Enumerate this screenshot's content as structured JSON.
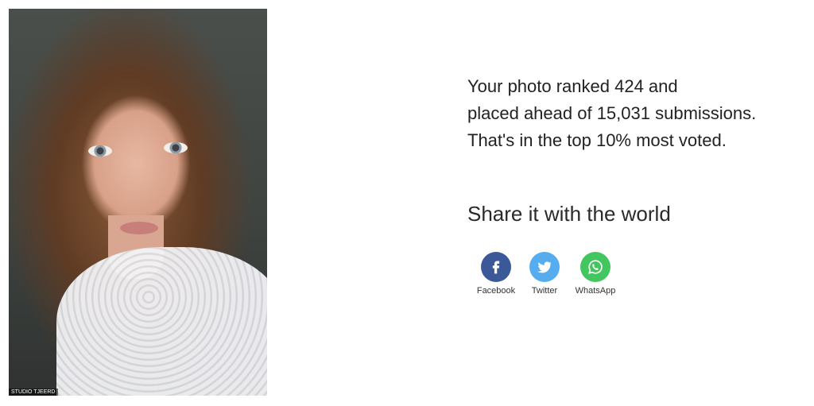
{
  "photo": {
    "watermark": "STUDIO TJEERD"
  },
  "result": {
    "line1": "Your photo ranked 424 and",
    "line2": "placed ahead of 15,031 submissions.",
    "line3": "That's in the top 10% most voted."
  },
  "share": {
    "title": "Share it with the world",
    "items": [
      {
        "label": "Facebook",
        "icon": "facebook-icon",
        "color": "#3b5998"
      },
      {
        "label": "Twitter",
        "icon": "twitter-icon",
        "color": "#55acee"
      },
      {
        "label": "WhatsApp",
        "icon": "whatsapp-icon",
        "color": "#43c55f"
      }
    ]
  }
}
